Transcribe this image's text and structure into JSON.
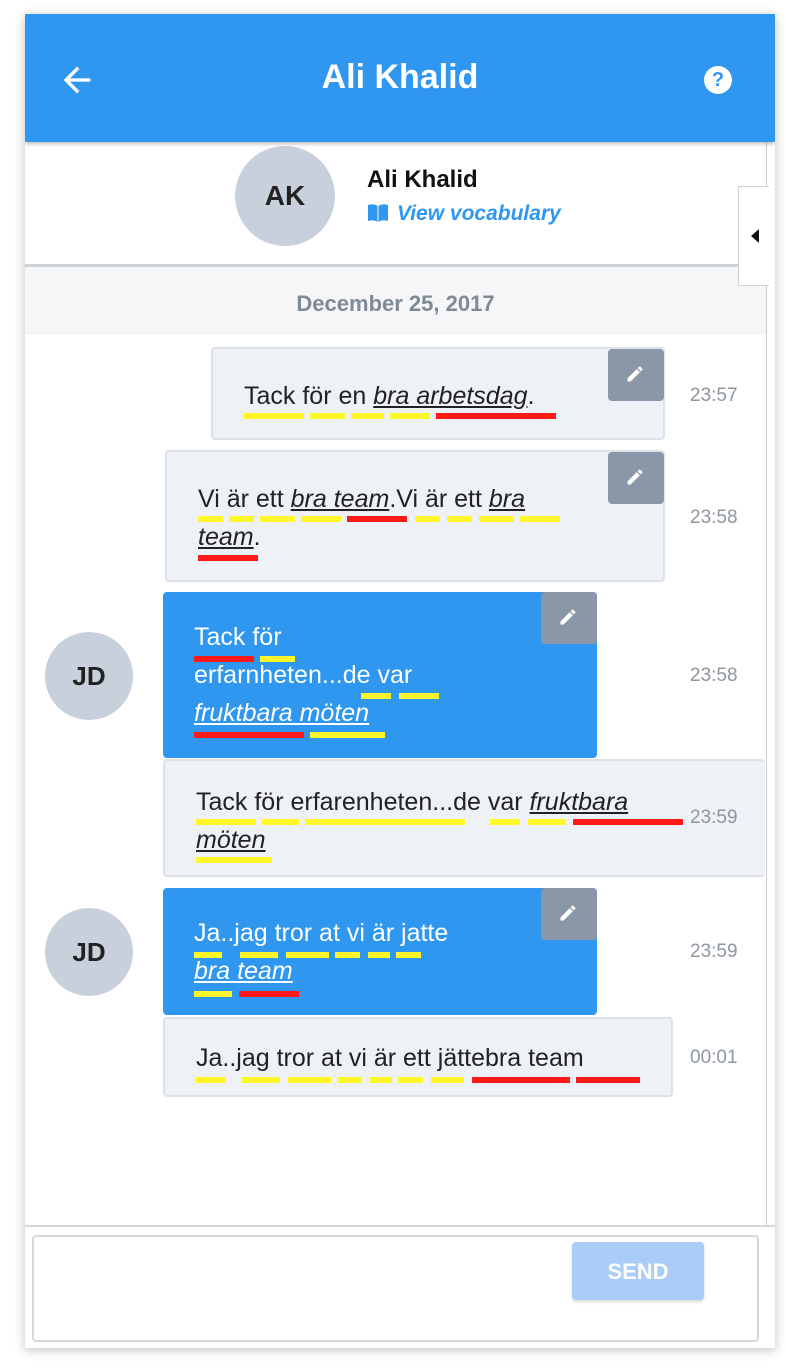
{
  "header": {
    "title": "Ali Khalid",
    "back_icon": "arrow-left-icon",
    "help_icon": "question-circle-icon"
  },
  "profile": {
    "initials": "AK",
    "name": "Ali Khalid",
    "vocab_label": "View vocabulary",
    "vocab_icon": "book-open-icon"
  },
  "date_separator": "December 25, 2017",
  "messages": [
    {
      "lines": [
        [
          {
            "t": "Tack för en "
          },
          {
            "t": "bra arbetsdag",
            "u": true
          },
          {
            "t": "."
          }
        ]
      ],
      "time": "23:57"
    },
    {
      "lines": [
        [
          {
            "t": "Vi är ett "
          },
          {
            "t": "bra team",
            "u": true
          },
          {
            "t": ".Vi är ett "
          },
          {
            "t": "bra",
            "u": true
          }
        ],
        [
          {
            "t": "team",
            "u": true
          },
          {
            "t": "."
          }
        ]
      ],
      "time": "23:58"
    },
    {
      "lines": [
        [
          {
            "t": "Tack för"
          }
        ],
        [
          {
            "t": "erfarnheten...de var"
          }
        ],
        [
          {
            "t": "fruktbara möten",
            "u": true
          }
        ]
      ],
      "time": "23:58",
      "sender": "JD"
    },
    {
      "lines": [
        [
          {
            "t": "Tack för erfarenheten...de var "
          },
          {
            "t": "fruktbara",
            "u": true
          }
        ],
        [
          {
            "t": "möten",
            "u": true
          }
        ]
      ],
      "time": "23:59"
    },
    {
      "lines": [
        [
          {
            "t": "Ja..jag tror at vi är jatte"
          }
        ],
        [
          {
            "t": "bra team",
            "u": true
          }
        ]
      ],
      "time": "23:59",
      "sender": "JD"
    },
    {
      "lines": [
        [
          {
            "t": "Ja..jag tror at vi är ett jättebra team"
          }
        ]
      ],
      "time": "00:01"
    }
  ],
  "composer": {
    "placeholder": "",
    "send_label": "SEND"
  },
  "colors": {
    "primary": "#2f97ef",
    "correct": "#fff72a",
    "error": "#ff1a1a",
    "send_disabled": "#a9cdf7"
  }
}
